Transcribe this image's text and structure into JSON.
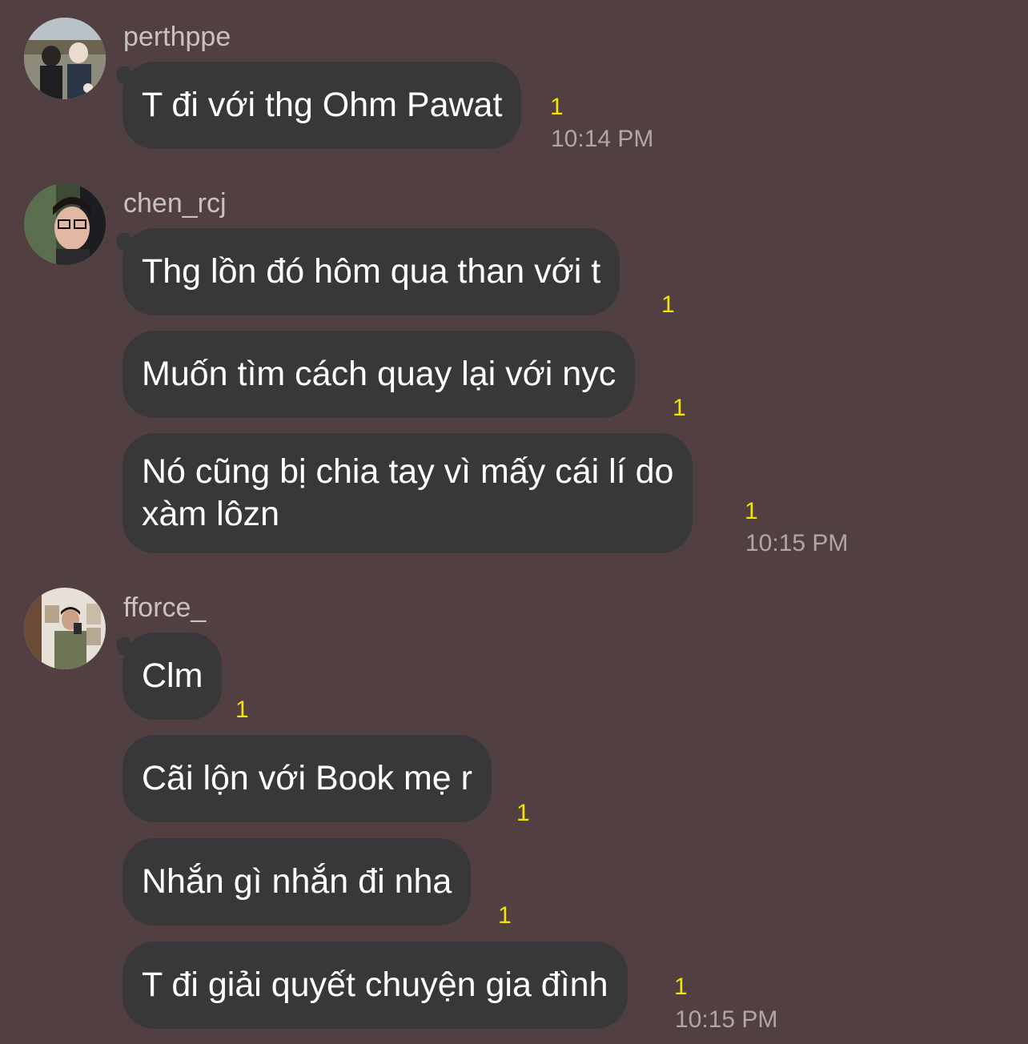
{
  "chat": {
    "groups": [
      {
        "username": "perthppe",
        "avatar": "avatar-perthppe",
        "messages": [
          {
            "text": "T đi với thg Ohm Pawat",
            "read": "1",
            "time": "10:14 PM"
          }
        ]
      },
      {
        "username": "chen_rcj",
        "avatar": "avatar-chen_rcj",
        "messages": [
          {
            "text": "Thg lồn đó hôm qua than với t",
            "read": "1"
          },
          {
            "text": "Muốn tìm cách quay lại với nyc",
            "read": "1"
          },
          {
            "text": "Nó cũng bị chia tay vì mấy cái lí do\nxàm lôzn",
            "read": "1",
            "time": "10:15 PM"
          }
        ]
      },
      {
        "username": "fforce_",
        "avatar": "avatar-fforce_",
        "messages": [
          {
            "text": "Clm",
            "read": "1"
          },
          {
            "text": "Cãi lộn với Book mẹ r",
            "read": "1"
          },
          {
            "text": "Nhắn gì nhắn đi nha",
            "read": "1"
          },
          {
            "text": "T đi giải quyết chuyện gia đình",
            "read": "1",
            "time": "10:15 PM"
          }
        ]
      }
    ]
  },
  "colors": {
    "background": "#523f41",
    "bubble": "#38383b",
    "read_indicator": "#f2e400",
    "timestamp": "#b0a6a7",
    "username": "#c9c1c2"
  }
}
